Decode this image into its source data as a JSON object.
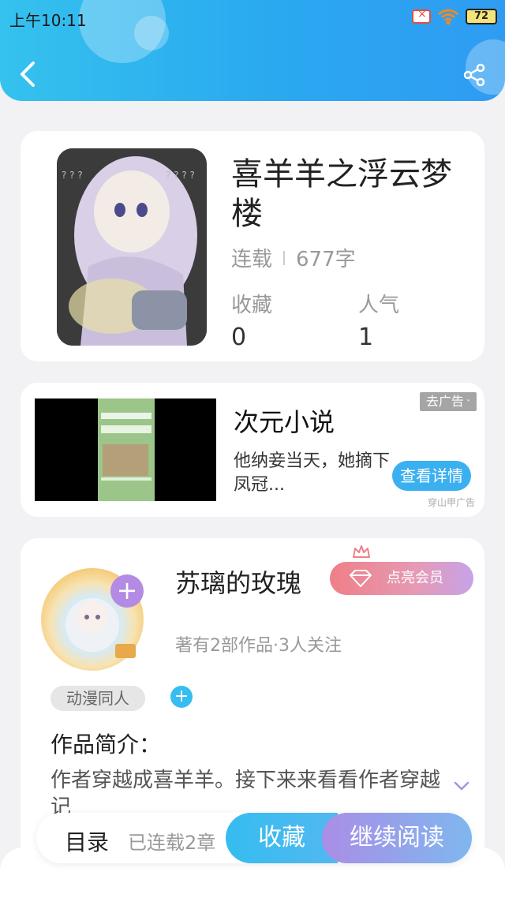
{
  "status_bar": {
    "time": "上午10:11",
    "battery": "72"
  },
  "header": {
    "back_icon": "back-arrow-icon",
    "share_icon": "share-icon"
  },
  "book": {
    "title": "喜羊羊之浮云梦楼",
    "status": "连载",
    "word_count": "677字",
    "stats": [
      {
        "label": "收藏",
        "value": "0"
      },
      {
        "label": "人气",
        "value": "1"
      }
    ]
  },
  "ad": {
    "title": "次元小说",
    "description": "他纳妾当天，她摘下凤冠...",
    "close_label": "去广告",
    "cta_label": "查看详情",
    "source": "穿山甲广告"
  },
  "author": {
    "name": "苏璃的玫瑰",
    "vip_label": "点亮会员",
    "stats": "著有2部作品·3人关注",
    "tag": "动漫同人",
    "intro_title": "作品简介：",
    "intro_text": "作者穿越成喜羊羊。接下来来看看作者穿越记"
  },
  "bottom_bar": {
    "toc_label": "目录",
    "chapters_label": "已连载2章",
    "favorite_label": "收藏",
    "continue_label": "继续阅读"
  },
  "colors": {
    "accent": "#2fa8f0",
    "vip_pink": "#ef7f87",
    "purple": "#b38ae4"
  }
}
